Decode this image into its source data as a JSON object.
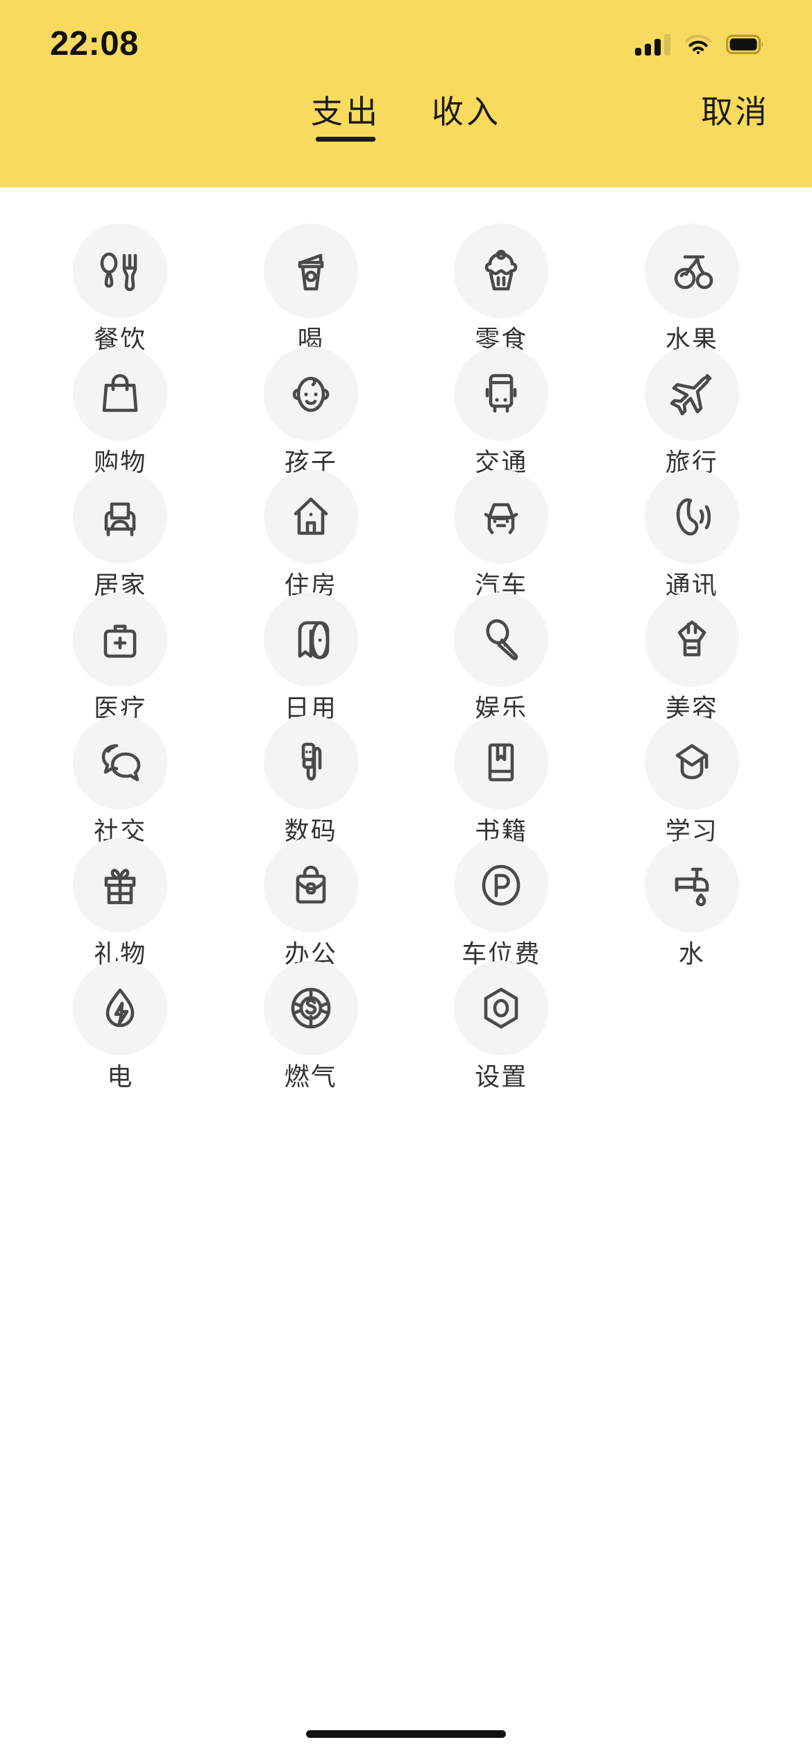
{
  "status_bar": {
    "time": "22:08",
    "signal_icon": "signal-bars-icon",
    "wifi_icon": "wifi-icon",
    "battery_icon": "battery-icon"
  },
  "header": {
    "background_color": "#f7da5e",
    "tabs": [
      {
        "label": "支出",
        "active": true
      },
      {
        "label": "收入",
        "active": false
      }
    ],
    "cancel_label": "取消"
  },
  "grid": {
    "columns": 4,
    "circle_color": "#f4f4f4",
    "icon_color": "#4a4a4a",
    "label_color": "#333333",
    "categories": [
      {
        "label": "餐饮",
        "icon": "spoon-fork-icon"
      },
      {
        "label": "喝",
        "icon": "coffee-cup-icon"
      },
      {
        "label": "零食",
        "icon": "cupcake-icon"
      },
      {
        "label": "水果",
        "icon": "cherry-icon"
      },
      {
        "label": "购物",
        "icon": "shopping-bag-icon"
      },
      {
        "label": "孩子",
        "icon": "baby-face-icon"
      },
      {
        "label": "交通",
        "icon": "bus-icon"
      },
      {
        "label": "旅行",
        "icon": "airplane-icon"
      },
      {
        "label": "居家",
        "icon": "armchair-icon"
      },
      {
        "label": "住房",
        "icon": "house-icon"
      },
      {
        "label": "汽车",
        "icon": "car-icon"
      },
      {
        "label": "通讯",
        "icon": "phone-call-icon"
      },
      {
        "label": "医疗",
        "icon": "first-aid-kit-icon"
      },
      {
        "label": "日用",
        "icon": "toilet-paper-icon"
      },
      {
        "label": "娱乐",
        "icon": "microphone-icon"
      },
      {
        "label": "美容",
        "icon": "makeup-brush-icon"
      },
      {
        "label": "社交",
        "icon": "chat-bubbles-icon"
      },
      {
        "label": "数码",
        "icon": "usb-cable-icon"
      },
      {
        "label": "书籍",
        "icon": "book-bookmark-icon"
      },
      {
        "label": "学习",
        "icon": "graduation-cap-icon"
      },
      {
        "label": "礼物",
        "icon": "gift-box-icon"
      },
      {
        "label": "办公",
        "icon": "briefcase-icon"
      },
      {
        "label": "车位费",
        "icon": "parking-p-icon"
      },
      {
        "label": "水",
        "icon": "faucet-drop-icon"
      },
      {
        "label": "电",
        "icon": "droplet-bolt-icon"
      },
      {
        "label": "燃气",
        "icon": "dollar-coin-icon"
      },
      {
        "label": "设置",
        "icon": "hex-nut-icon"
      }
    ]
  },
  "home_indicator": {
    "visible": true
  }
}
